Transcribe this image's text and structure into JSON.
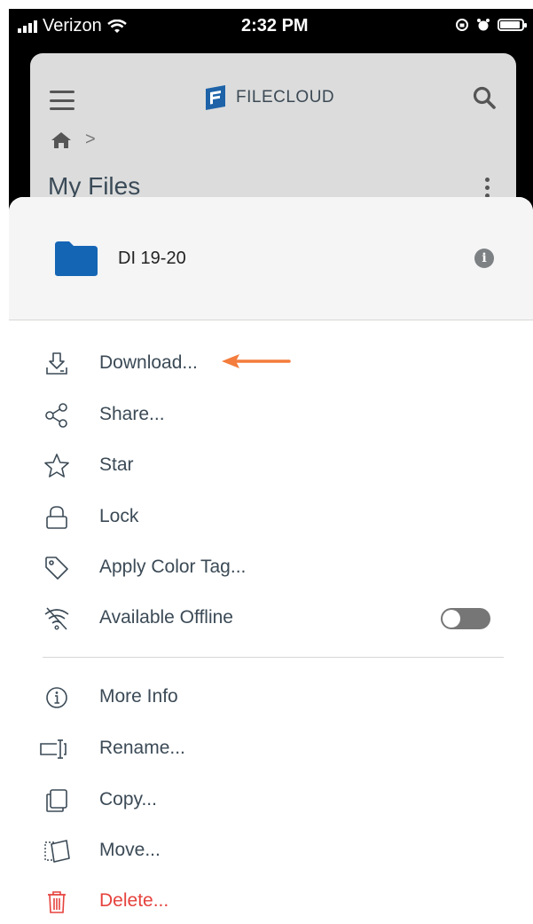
{
  "status_bar": {
    "carrier": "Verizon",
    "time": "2:32 PM"
  },
  "app": {
    "logo_text": "FILECLOUD",
    "page_title": "My Files",
    "breadcrumb_sep": ">"
  },
  "sheet": {
    "folder_name": "DI 19-20",
    "actions_primary": [
      {
        "label": "Download...",
        "icon": "download-icon"
      },
      {
        "label": "Share...",
        "icon": "share-icon"
      },
      {
        "label": "Star",
        "icon": "star-icon"
      },
      {
        "label": "Lock",
        "icon": "lock-icon"
      },
      {
        "label": "Apply Color Tag...",
        "icon": "tag-icon"
      },
      {
        "label": "Available Offline",
        "icon": "wifi-off-icon",
        "toggle": false
      }
    ],
    "actions_secondary": [
      {
        "label": "More Info",
        "icon": "info-icon"
      },
      {
        "label": "Rename...",
        "icon": "rename-icon"
      },
      {
        "label": "Copy...",
        "icon": "copy-icon"
      },
      {
        "label": "Move...",
        "icon": "move-icon"
      },
      {
        "label": "Delete...",
        "icon": "trash-icon"
      }
    ]
  },
  "colors": {
    "accent_folder": "#1565b5",
    "danger": "#e6423d",
    "arrow": "#f47c3c"
  }
}
